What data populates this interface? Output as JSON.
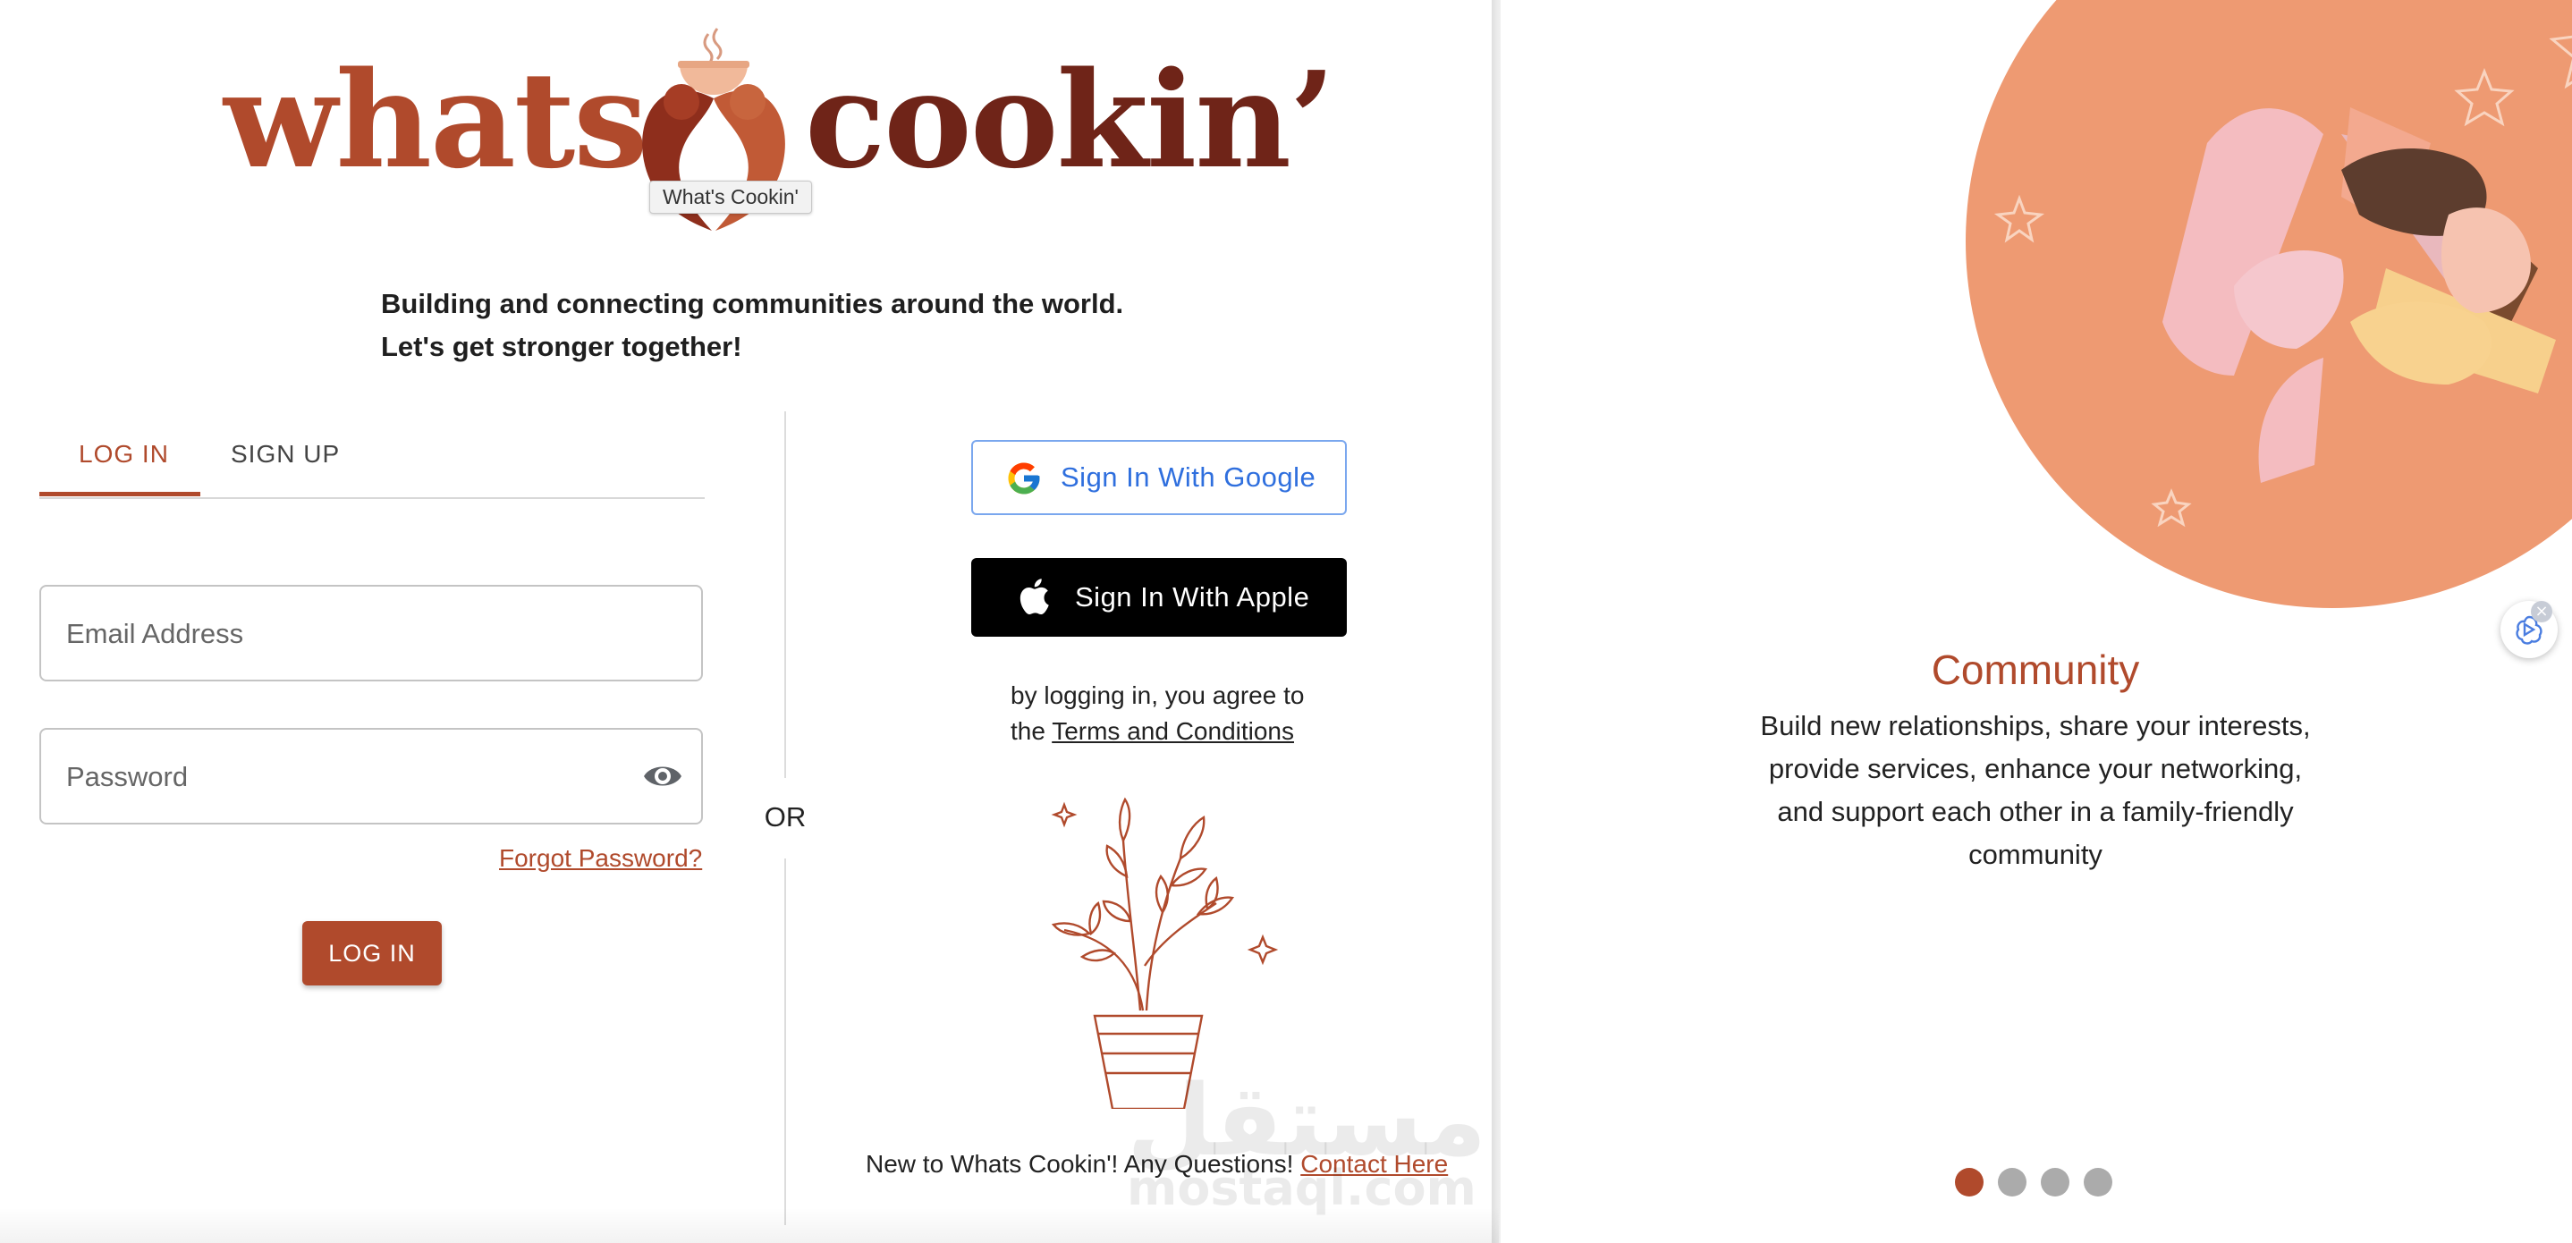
{
  "brand": {
    "logo_word_1": "whats",
    "logo_word_2": "cookin’",
    "logo_tooltip": "What's Cookin'",
    "primary_color": "#b04a2c",
    "dark_color": "#6f2418"
  },
  "tagline": {
    "line1": "Building and connecting communities around the world.",
    "line2": "Let's get stronger together!"
  },
  "auth_tabs": {
    "login_label": "LOG IN",
    "signup_label": "SIGN UP",
    "active": "LOG IN"
  },
  "login_form": {
    "email_placeholder": "Email Address",
    "email_value": "",
    "password_placeholder": "Password",
    "password_value": "",
    "forgot_label": "Forgot Password?",
    "submit_label": "LOG IN"
  },
  "divider": {
    "or_label": "OR"
  },
  "social": {
    "google_label": "Sign In With Google",
    "apple_label": "Sign In With Apple",
    "terms_prefix_line1": "by logging in, you agree to",
    "terms_prefix_line2": "the ",
    "terms_link": "Terms and Conditions"
  },
  "footer": {
    "text": "New to Whats Cookin'! Any Questions! ",
    "contact_link": "Contact Here"
  },
  "watermark": {
    "arabic": "مستقل",
    "latin": "mostaql.com"
  },
  "carousel": {
    "title": "Community",
    "description_lines": [
      "Build new relationships, share your interests,",
      "provide services, enhance your networking,",
      "and support each other in a family-friendly",
      "community"
    ],
    "slide_count": 4,
    "active_slide": 1,
    "illustration_color": "#ee9a72"
  },
  "icons": {
    "eye": "eye-icon",
    "google": "google-icon",
    "apple": "apple-icon",
    "assistant": "assistant-icon"
  }
}
